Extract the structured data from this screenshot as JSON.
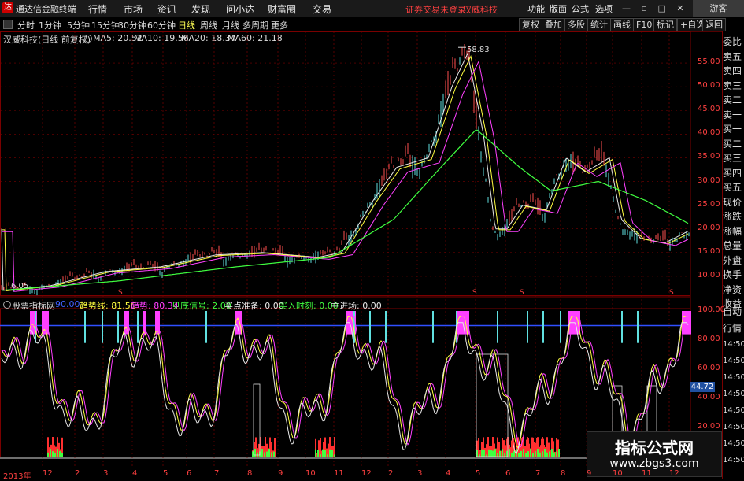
{
  "app": {
    "logo_glyph": "达",
    "title": "通达信金融终端",
    "menu": [
      "行情",
      "市场",
      "资讯",
      "发现",
      "问小达",
      "财富圈",
      "交易"
    ],
    "warning": "证券交易未登录",
    "stock_name_header": "汉威科技",
    "toolbar": [
      "功能",
      "版面",
      "公式",
      "选项"
    ],
    "guest": "游客"
  },
  "periodbar": {
    "periods": [
      "分时",
      "1分钟",
      "5分钟",
      "15分钟",
      "30分钟",
      "60分钟",
      "日线",
      "周线",
      "月线",
      "多周期",
      "更多"
    ],
    "active": "日线",
    "right_buttons": [
      "复权",
      "叠加",
      "多股",
      "统计",
      "画线",
      "F10",
      "标记",
      "+自选",
      "返回"
    ]
  },
  "main_chart": {
    "title": "汉威科技(日线 前复权)",
    "ma": [
      {
        "label": "MA5: 20.52",
        "color": "#e8e8e8"
      },
      {
        "label": "MA10: 19.56",
        "color": "#ffff40"
      },
      {
        "label": "MA20: 18.37",
        "color": "#ff40ff"
      },
      {
        "label": "MA60: 21.18",
        "color": "#40ff40"
      }
    ],
    "high_label": "58.83",
    "low_label": "6.05",
    "y_ticks": [
      "55.00",
      "50.00",
      "45.00",
      "40.00",
      "35.00",
      "30.00",
      "25.00",
      "20.00",
      "15.00",
      "10.00"
    ],
    "y_range": [
      6,
      58
    ]
  },
  "indicator": {
    "name": "股票指标网",
    "values": [
      {
        "label": "90.00",
        "color": "#4060ff"
      },
      {
        "label": "趋势线: 81.56",
        "color": "#ffff40"
      },
      {
        "label": "趋势: 80.34",
        "color": "#ff40ff"
      },
      {
        "label": "见底信号: 2.00",
        "color": "#40ff40"
      },
      {
        "label": "买点准备: 0.00",
        "color": "#e8e8e8"
      },
      {
        "label": "买入时刻: 0.00",
        "color": "#40ff40"
      },
      {
        "label": "主进场: 0.00",
        "color": "#e8e8e8"
      }
    ],
    "y_ticks": [
      "100.00",
      "80.00",
      "60.00",
      "40.00",
      "20.00"
    ],
    "current_tag": "44.72"
  },
  "time_axis": [
    "2013年",
    "12",
    "2",
    "3",
    "4",
    "5",
    "6",
    "7",
    "8",
    "9",
    "10",
    "11",
    "12",
    "2",
    "3",
    "4",
    "5",
    "6",
    "7",
    "8",
    "9",
    "10",
    "11",
    "12"
  ],
  "right_panel": {
    "items_top": [
      "委比",
      "卖五",
      "卖四",
      "卖三",
      "卖二",
      "卖一",
      "买一",
      "买二",
      "买三",
      "买四",
      "买五",
      "现价",
      "涨跌",
      "涨幅",
      "总量",
      "外盘",
      "换手",
      "净资",
      "收益"
    ],
    "items_bottom": [
      "自动",
      "行情",
      "14:50",
      "14:50",
      "14:50",
      "14:50",
      "14:50",
      "14:50",
      "14:50",
      "14:50"
    ]
  },
  "watermark": {
    "line1": "指标公式网",
    "line2": "www.zbgs3.com"
  },
  "colors": {
    "accent_red": "#ff4040",
    "magenta": "#ff40ff",
    "cyan": "#60e0e0",
    "grid": "#7a0000"
  }
}
